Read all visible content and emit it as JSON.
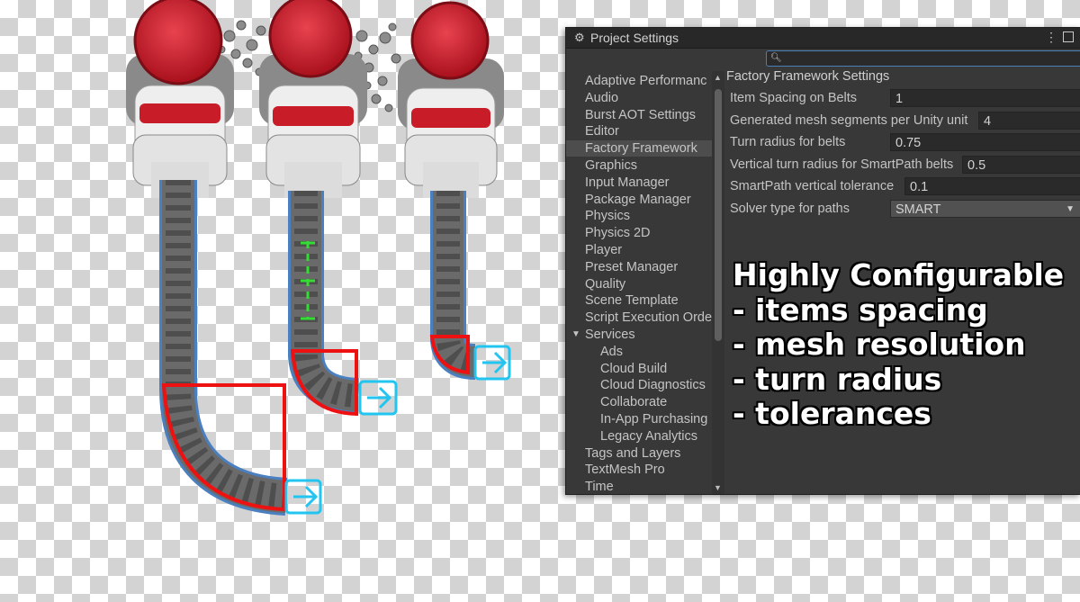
{
  "window": {
    "title": "Project Settings",
    "search": {
      "value": "",
      "placeholder": ""
    }
  },
  "nav": {
    "items": [
      {
        "label": "Adaptive Performanc",
        "indent": 0
      },
      {
        "label": "Audio",
        "indent": 0
      },
      {
        "label": "Burst AOT Settings",
        "indent": 0
      },
      {
        "label": "Editor",
        "indent": 0
      },
      {
        "label": "Factory Framework",
        "indent": 0,
        "selected": true
      },
      {
        "label": "Graphics",
        "indent": 0
      },
      {
        "label": "Input Manager",
        "indent": 0
      },
      {
        "label": "Package Manager",
        "indent": 0
      },
      {
        "label": "Physics",
        "indent": 0
      },
      {
        "label": "Physics 2D",
        "indent": 0
      },
      {
        "label": "Player",
        "indent": 0
      },
      {
        "label": "Preset Manager",
        "indent": 0
      },
      {
        "label": "Quality",
        "indent": 0
      },
      {
        "label": "Scene Template",
        "indent": 0
      },
      {
        "label": "Script Execution Orde",
        "indent": 0
      },
      {
        "label": "Services",
        "indent": 0,
        "expanded": true
      },
      {
        "label": "Ads",
        "indent": 1
      },
      {
        "label": "Cloud Build",
        "indent": 1
      },
      {
        "label": "Cloud Diagnostics",
        "indent": 1
      },
      {
        "label": "Collaborate",
        "indent": 1
      },
      {
        "label": "In-App Purchasing",
        "indent": 1
      },
      {
        "label": "Legacy Analytics",
        "indent": 1
      },
      {
        "label": "Tags and Layers",
        "indent": 0
      },
      {
        "label": "TextMesh Pro",
        "indent": 0
      },
      {
        "label": "Time",
        "indent": 0
      }
    ]
  },
  "content": {
    "title": "Factory Framework Settings",
    "rows": [
      {
        "label": "Item Spacing on Belts",
        "value": "1"
      },
      {
        "label": "Generated mesh segments per Unity unit",
        "value": "4"
      },
      {
        "label": "Turn radius for belts",
        "value": "0.75"
      },
      {
        "label": "Vertical turn radius for SmartPath belts",
        "value": "0.5"
      },
      {
        "label": "SmartPath vertical tolerance",
        "value": "0.1"
      },
      {
        "label": "Solver type for paths",
        "value": "SMART",
        "type": "dropdown"
      }
    ]
  },
  "feature": {
    "lines": [
      "Highly Configurable",
      "- items spacing",
      "- mesh resolution",
      "- turn radius",
      "- tolerances"
    ]
  },
  "icons": {
    "gear": "gear-icon",
    "menu": "kebab-menu-icon",
    "maximize": "maximize-icon",
    "search": "search-icon",
    "dropdown": "chevron-down-icon",
    "belt_end": "arrow-right-icon"
  },
  "colors": {
    "turn_highlight": "#ee1111",
    "arrow_marker": "#22c4f0",
    "gizmo": "#33dd33",
    "machine_red": "#d0222d"
  }
}
